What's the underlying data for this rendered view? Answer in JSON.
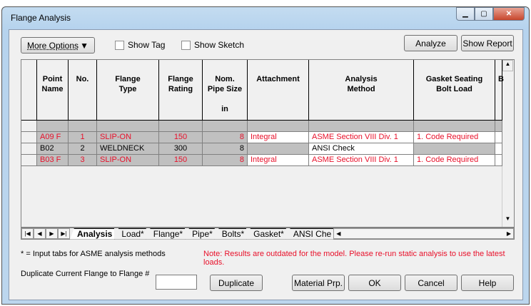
{
  "window": {
    "title": "Flange Analysis"
  },
  "toolbar": {
    "more_options": "More Options",
    "show_tag": "Show Tag",
    "show_sketch": "Show Sketch",
    "analyze": "Analyze",
    "show_report": "Show Report"
  },
  "grid": {
    "headers": [
      [
        "Point",
        "Name"
      ],
      [
        "No."
      ],
      [
        "Flange",
        "Type"
      ],
      [
        "Flange",
        "Rating"
      ],
      [
        "Nom.",
        "Pipe Size",
        "",
        "in"
      ],
      [
        "Attachment"
      ],
      [
        "Analysis",
        "Method"
      ],
      [
        "Gasket Seating",
        "Bolt Load"
      ],
      [
        "B"
      ]
    ],
    "rows": [
      {
        "point": "A09 F",
        "no": "1",
        "type": "SLIP-ON",
        "rating": "150",
        "size": "8",
        "attachment": "Integral",
        "method": "ASME Section VIII Div. 1",
        "gasket": "1.   Code Required",
        "color": "#e8102a"
      },
      {
        "point": "B02",
        "no": "2",
        "type": "WELDNECK",
        "rating": "300",
        "size": "8",
        "attachment": "",
        "method": "ANSI Check",
        "gasket": "",
        "color": "#000000"
      },
      {
        "point": "B03 F",
        "no": "3",
        "type": "SLIP-ON",
        "rating": "150",
        "size": "8",
        "attachment": "Integral",
        "method": "ASME Section VIII Div. 1",
        "gasket": "1.   Code Required",
        "color": "#e8102a"
      }
    ]
  },
  "tabs": [
    "Analysis",
    "Load*",
    "Flange*",
    "Pipe*",
    "Bolts*",
    "Gasket*",
    "ANSI Che"
  ],
  "footer": {
    "legend": "* = Input tabs for ASME analysis methods",
    "warning": "Note: Results are outdated for the model. Please re-run static analysis to use the latest loads.",
    "duplicate_label": "Duplicate Current Flange to Flange #",
    "duplicate_value": "",
    "duplicate": "Duplicate",
    "material": "Material Prp.",
    "ok": "OK",
    "cancel": "Cancel",
    "help": "Help"
  }
}
